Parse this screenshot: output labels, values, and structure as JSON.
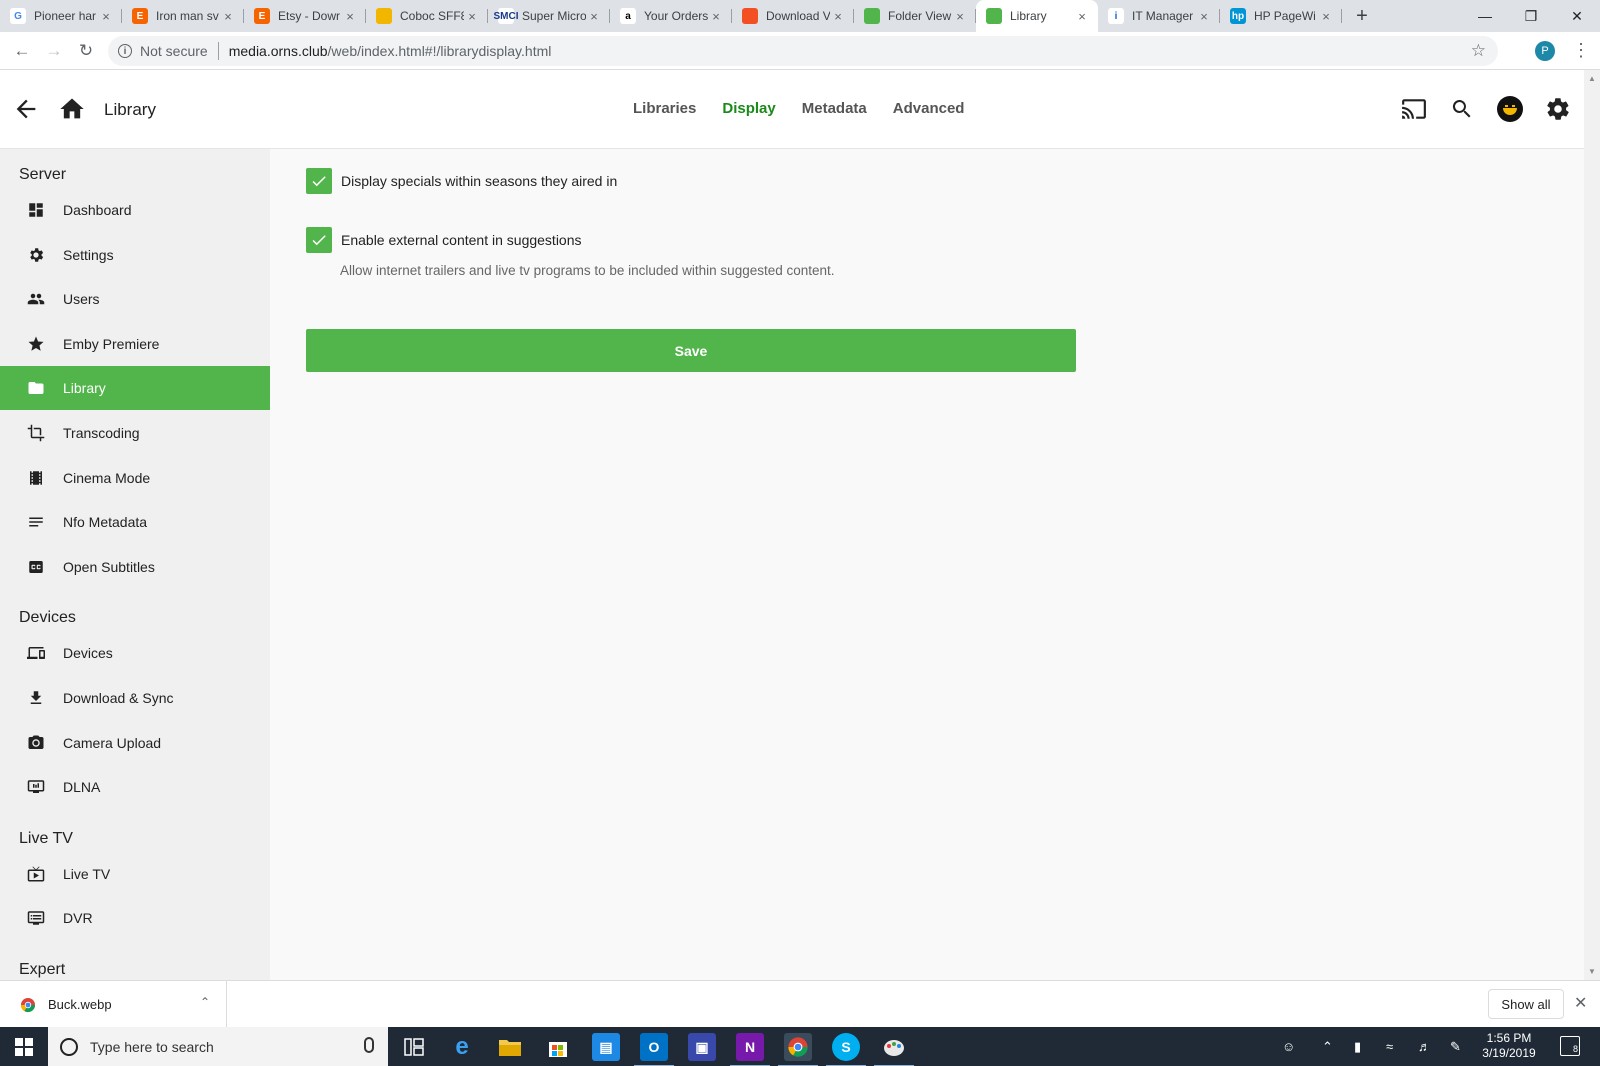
{
  "browser": {
    "tabs": [
      {
        "title": "Pioneer har",
        "favicon": "G",
        "color": "#ffffff",
        "fg": "#4285f4"
      },
      {
        "title": "Iron man sv",
        "favicon": "E",
        "color": "#f56400",
        "fg": "#ffffff"
      },
      {
        "title": "Etsy - Dowr",
        "favicon": "E",
        "color": "#f56400",
        "fg": "#ffffff"
      },
      {
        "title": "Coboc SFF8",
        "favicon": "",
        "color": "#f2b600",
        "fg": "#ffffff"
      },
      {
        "title": "Super Micro",
        "favicon": "SMCI",
        "color": "#ffffff",
        "fg": "#1a3b8a"
      },
      {
        "title": "Your Orders",
        "favicon": "a",
        "color": "#ffffff",
        "fg": "#000000"
      },
      {
        "title": "Download V",
        "favicon": "",
        "color": "#f25022",
        "fg": "#ffffff"
      },
      {
        "title": "Folder View",
        "favicon": "",
        "color": "#52b54b",
        "fg": "#ffffff"
      },
      {
        "title": "Library",
        "favicon": "",
        "color": "#52b54b",
        "fg": "#ffffff"
      },
      {
        "title": "IT Manager",
        "favicon": "i",
        "color": "#ffffff",
        "fg": "#1565c0"
      },
      {
        "title": "HP PageWi",
        "favicon": "hp",
        "color": "#0096d6",
        "fg": "#ffffff"
      }
    ],
    "active_tab": 8,
    "close_glyph": "×",
    "new_tab_glyph": "+",
    "security_label": "Not secure",
    "url_host": "media.orns.club",
    "url_path": "/web/index.html#!/librarydisplay.html",
    "profile_initial": "P"
  },
  "header": {
    "title": "Library",
    "tabs": [
      "Libraries",
      "Display",
      "Metadata",
      "Advanced"
    ],
    "active_tab": "Display"
  },
  "sidebar": {
    "sections": [
      {
        "title": "Server",
        "items": [
          {
            "label": "Dashboard",
            "icon": "dashboard-icon"
          },
          {
            "label": "Settings",
            "icon": "gear-icon"
          },
          {
            "label": "Users",
            "icon": "users-icon"
          },
          {
            "label": "Emby Premiere",
            "icon": "star-icon"
          },
          {
            "label": "Library",
            "icon": "folder-icon",
            "active": true
          },
          {
            "label": "Transcoding",
            "icon": "crop-icon"
          },
          {
            "label": "Cinema Mode",
            "icon": "film-icon"
          },
          {
            "label": "Nfo Metadata",
            "icon": "lines-icon"
          },
          {
            "label": "Open Subtitles",
            "icon": "cc-icon"
          }
        ]
      },
      {
        "title": "Devices",
        "items": [
          {
            "label": "Devices",
            "icon": "devices-icon"
          },
          {
            "label": "Download & Sync",
            "icon": "download-icon"
          },
          {
            "label": "Camera Upload",
            "icon": "camera-icon"
          },
          {
            "label": "DLNA",
            "icon": "dlna-icon"
          }
        ]
      },
      {
        "title": "Live TV",
        "items": [
          {
            "label": "Live TV",
            "icon": "tv-icon"
          },
          {
            "label": "DVR",
            "icon": "dvr-icon"
          }
        ]
      },
      {
        "title": "Expert",
        "items": []
      }
    ]
  },
  "settings": {
    "display_specials_label": "Display specials within seasons they aired in",
    "display_specials_checked": true,
    "external_content_label": "Enable external content in suggestions",
    "external_content_checked": true,
    "external_content_help": "Allow internet trailers and live tv programs to be included within suggested content.",
    "save_label": "Save"
  },
  "download_shelf": {
    "file_name": "Buck.webp",
    "show_all_label": "Show all"
  },
  "taskbar": {
    "search_placeholder": "Type here to search",
    "time": "1:56 PM",
    "date": "3/19/2019",
    "notification_count": "8"
  },
  "colors": {
    "accent": "#52b54b",
    "active_tab_text": "#1a8a1a",
    "sidebar_bg": "#f0f0f0",
    "taskbar_bg": "#1f2a36"
  }
}
